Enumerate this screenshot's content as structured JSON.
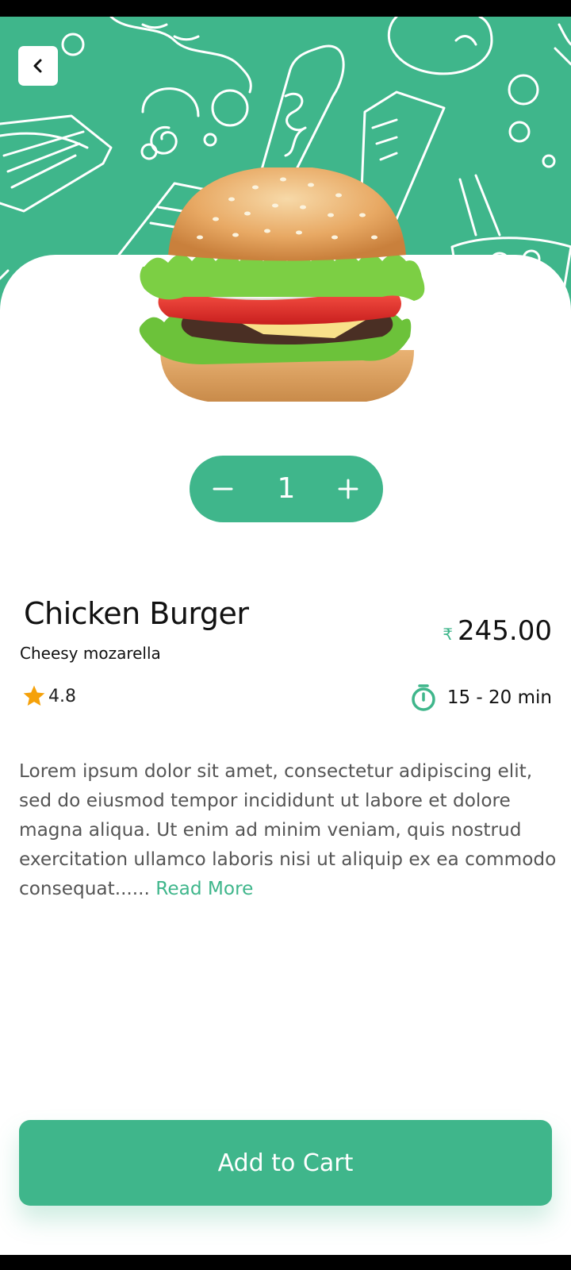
{
  "header": {
    "back_icon": "chevron-left-icon"
  },
  "product": {
    "name": "Chicken Burger",
    "subtitle": "Cheesy mozarella",
    "currency_symbol": "₹",
    "price": "245.00",
    "rating": "4.8",
    "delivery_time": "15 - 20 min",
    "description": "Lorem ipsum dolor sit amet, consectetur adipiscing elit, sed do eiusmod tempor incididunt ut labore et dolore magna aliqua. Ut enim ad minim veniam, quis nostrud exercitation ullamco laboris nisi ut aliquip ex ea commodo consequat......",
    "read_more": "Read More"
  },
  "quantity": {
    "value": "1",
    "minus_icon": "minus-icon",
    "plus_icon": "plus-icon"
  },
  "actions": {
    "add_to_cart": "Add to Cart"
  },
  "colors": {
    "accent": "#3fb68b",
    "star": "#f5a10a",
    "text": "#111111",
    "muted_text": "#555555"
  }
}
